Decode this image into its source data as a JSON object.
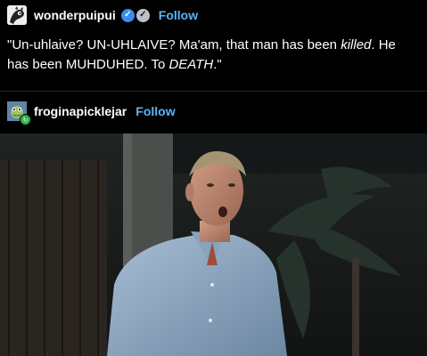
{
  "post1": {
    "username": "wonderpuipui",
    "follow_label": "Follow",
    "quote": {
      "part1": "\"Un-uhlaive?  UN-UHLAIVE?  Ma'am, that man has been ",
      "em1": "killed",
      "part2": ".  He has been MUHDUHED.  To ",
      "em2": "DEATH",
      "part3": ".\""
    }
  },
  "post2": {
    "username": "froginapicklejar",
    "follow_label": "Follow"
  },
  "colors": {
    "background": "#000000",
    "text": "#ffffff",
    "follow": "#5bb3f7",
    "verified_badge": "#3a8df0"
  },
  "icons": {
    "verified": "verified-badge-icon",
    "secondary": "secondary-badge-icon"
  }
}
